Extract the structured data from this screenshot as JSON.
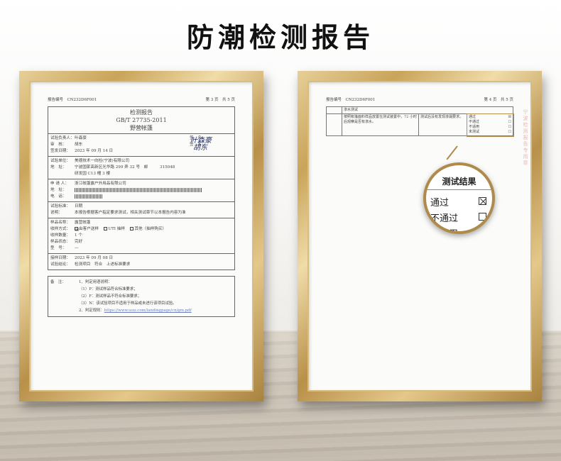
{
  "title": "防潮检测报告",
  "left_report": {
    "report_no_label": "报告编号",
    "report_no": "CN232D6F001",
    "page": "第 3 页　共 5 页",
    "report_title": "检测报告",
    "standard": "GB/T 27735-2011",
    "product_title": "野营帐篷",
    "rows": [
      {
        "k": "试验负责人：",
        "v": "叶森豪"
      },
      {
        "k": "审　核：",
        "v": "胡东"
      },
      {
        "k": "签发日期：",
        "v": "2023 年 09 月 14 日"
      }
    ],
    "sign_label_1": "签　名：",
    "sign_label_2": "签　名：",
    "signature_1": "叶森豪",
    "signature_2": "胡东",
    "org_rows": [
      {
        "k": "试验单位：",
        "v": "美德技术一向检(宁波)有限公司"
      },
      {
        "k": "地　址：",
        "v": "宁波国家高新区光华路 299 弄 32 号　邮　　　315048"
      },
      {
        "k": "",
        "v": "研发园 C13 幢 3 楼"
      }
    ],
    "applicant_rows": [
      {
        "k": "申 请 人：",
        "v": "浙江帐篷露户外用品有限公司"
      },
      {
        "k": "地　址：",
        "v": ""
      },
      {
        "k": "电　话：",
        "v": ""
      }
    ],
    "test_rows": [
      {
        "k": "试验标准：",
        "v": "日期"
      },
      {
        "k": "说明：",
        "v": "本报告根据客户指定要求测试，相关测试章节以本报告内容为准"
      }
    ],
    "sample_rows": [
      {
        "k": "样品名称：",
        "v": "露营帐篷"
      },
      {
        "k": "收样方式：",
        "v": ""
      },
      {
        "k": "收样数量：",
        "v": "1 个"
      },
      {
        "k": "样品状态：",
        "v": "完好"
      },
      {
        "k": "型　号：",
        "v": "—"
      }
    ],
    "receive_options": [
      "由客户送样",
      "UTI 抽样",
      "其他（抽样购买）"
    ],
    "date_rows": [
      {
        "k": "接样日期：",
        "v": "2023 年 09 月 08 日"
      },
      {
        "k": "试验结论：",
        "v": "检测项目　符合　上述标准要求"
      }
    ],
    "note_label": "备　注：",
    "notes": [
      "1、判定用语说明：",
      "（1）P：测试样品符合标准要求；",
      "（2）F：测试样品不符合标准要求；",
      "（3）N：该试验项目不适用于样品或未进行该项目试验。",
      "2、判定规则："
    ],
    "note_link": "https://www.uuu.com/landingpage/cn/gm.pdf"
  },
  "right_report": {
    "report_no_label": "报告编号",
    "report_no": "CN232D6F001",
    "page": "第 4 页　共 5 页",
    "table_head": "渗水测试",
    "table_desc": "按照帐篷面料样品放置在测试装置中，72 小时后观察是否有渗水。",
    "table_result": "测试后没有发现渗漏要求。",
    "options": [
      "通过",
      "不通过",
      "不适用",
      "未测试"
    ],
    "stamp_text": "宁波检测报告专用章"
  },
  "magnifier": {
    "heading": "测试结果",
    "rows": [
      {
        "label": "通过",
        "checked": true
      },
      {
        "label": "不通过",
        "checked": false
      },
      {
        "label": "不适用",
        "checked": false
      }
    ]
  }
}
